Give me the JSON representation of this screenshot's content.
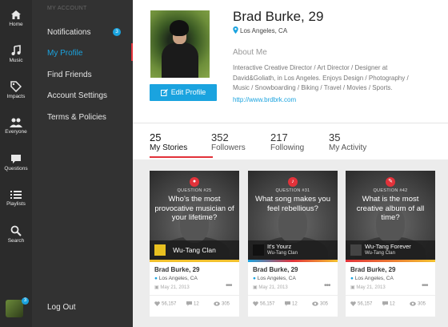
{
  "rail": [
    {
      "label": "Home",
      "icon": "home-icon"
    },
    {
      "label": "Music",
      "icon": "music-icon"
    },
    {
      "label": "Impacts",
      "icon": "tag-icon"
    },
    {
      "label": "Everyone",
      "icon": "people-icon"
    },
    {
      "label": "Questions",
      "icon": "chat-icon"
    },
    {
      "label": "Playlists",
      "icon": "list-icon"
    },
    {
      "label": "Search",
      "icon": "search-icon"
    }
  ],
  "rail_badge": "3",
  "menu": {
    "header": "MY ACCOUNT",
    "items": [
      {
        "label": "Notifications",
        "badge": "3"
      },
      {
        "label": "My Profile"
      },
      {
        "label": "Find Friends"
      },
      {
        "label": "Account Settings"
      },
      {
        "label": "Terms & Policies"
      }
    ],
    "logout": "Log Out"
  },
  "profile": {
    "name": "Brad Burke, 29",
    "location": "Los Angeles, CA",
    "edit_label": "Edit Profile",
    "about_heading": "About Me",
    "bio": "Interactive Creative Director / Art Director / Designer at David&Goliath, in Los Angeles. Enjoys Design / Photography / Music / Snowboarding / Biking / Travel / Movies / Sports.",
    "link": "http://www.brdbrk.com"
  },
  "stats": [
    {
      "num": "25",
      "label": "My Stories"
    },
    {
      "num": "352",
      "label": "Followers"
    },
    {
      "num": "217",
      "label": "Following"
    },
    {
      "num": "35",
      "label": "My Activity"
    }
  ],
  "colors": {
    "accent_blue": "#1aa3df",
    "accent_red": "#e2323a"
  },
  "cards": [
    {
      "q_label": "QUESTION #25",
      "question": "Who's the most provocative musician of your lifetime?",
      "album_title": "Wu-Tang Clan",
      "album_artist": "",
      "author": "Brad Burke, 29",
      "location": "Los Angeles, CA",
      "date": "May 21, 2013",
      "likes": "56,157",
      "comments": "12",
      "views": "305",
      "accent": "#f2c12e"
    },
    {
      "q_label": "QUESTION #31",
      "question": "What song makes you feel rebellious?",
      "album_title": "It's Yourz",
      "album_artist": "Wu-Tang Clan",
      "author": "Brad Burke, 29",
      "location": "Los Angeles, CA",
      "date": "May 21, 2013",
      "likes": "56,157",
      "comments": "12",
      "views": "305",
      "accent": "linear-gradient(90deg,#1aa3df,#e2323a,#f2c12e)"
    },
    {
      "q_label": "QUESTION #42",
      "question": "What is the most creative album of all time?",
      "album_title": "Wu-Tang Forever",
      "album_artist": "Wu-Tang Clan",
      "author": "Brad Burke, 29",
      "location": "Los Angeles, CA",
      "date": "May 21, 2013",
      "likes": "56,157",
      "comments": "12",
      "views": "305",
      "accent": "linear-gradient(90deg,#e2323a,#f2c12e)"
    }
  ]
}
